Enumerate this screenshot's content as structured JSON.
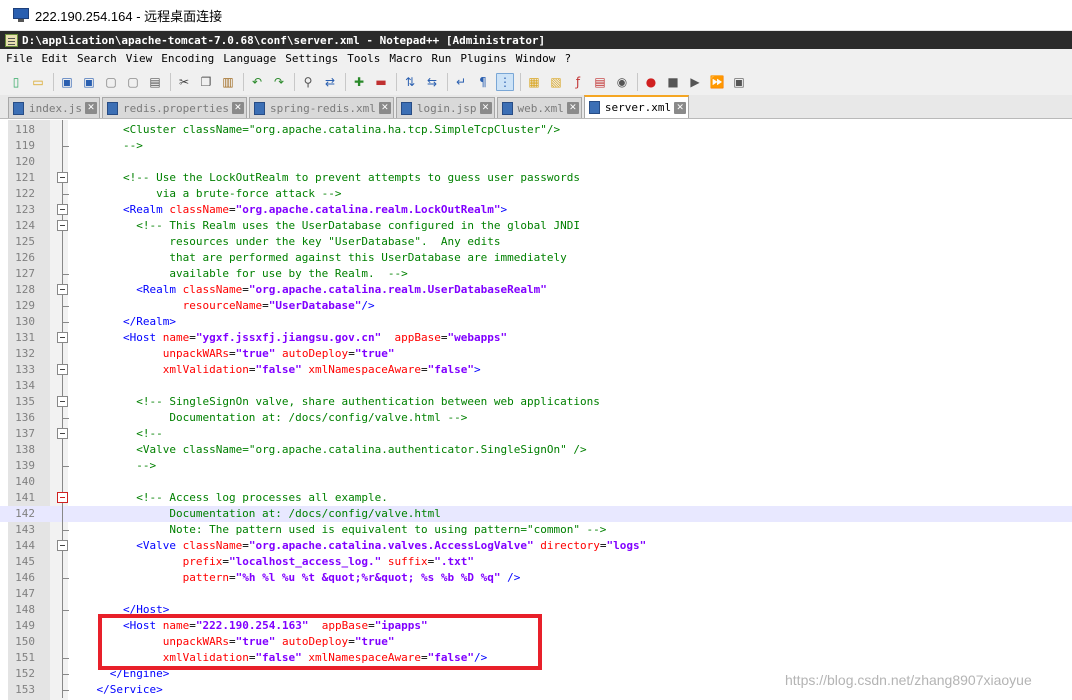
{
  "rdp": {
    "title": "222.190.254.164 - 远程桌面连接"
  },
  "window": {
    "title": "D:\\application\\apache-tomcat-7.0.68\\conf\\server.xml - Notepad++ [Administrator]"
  },
  "menu": [
    "File",
    "Edit",
    "Search",
    "View",
    "Encoding",
    "Language",
    "Settings",
    "Tools",
    "Macro",
    "Run",
    "Plugins",
    "Window",
    "?"
  ],
  "tabs": [
    {
      "label": "index.js",
      "active": false
    },
    {
      "label": "redis.properties",
      "active": false
    },
    {
      "label": "spring-redis.xml",
      "active": false
    },
    {
      "label": "login.jsp",
      "active": false
    },
    {
      "label": "web.xml",
      "active": false
    },
    {
      "label": "server.xml",
      "active": true
    }
  ],
  "toolbar": [
    "new-icon",
    "open-icon",
    "save-icon",
    "save-all-icon",
    "close-icon",
    "close-all-icon",
    "print-icon",
    "cut-icon",
    "copy-icon",
    "paste-icon",
    "undo-icon",
    "redo-icon",
    "find-icon",
    "replace-icon",
    "zoom-in-icon",
    "zoom-out-icon",
    "sync-v-icon",
    "sync-h-icon",
    "wrap-icon",
    "all-chars-icon",
    "indent-guide-icon",
    "udl-icon",
    "doc-map-icon",
    "function-list-icon",
    "folder-workspace-icon",
    "monitor-icon",
    "record-icon",
    "stop-icon",
    "play-icon",
    "run-multiple-icon",
    "save-macro-icon"
  ],
  "lines": [
    {
      "n": "118",
      "t": [
        [
          "        ",
          "txt"
        ],
        [
          "<Cluster className=\"org.apache.catalina.ha.tcp.SimpleTcpCluster\"/>",
          "com"
        ]
      ]
    },
    {
      "n": "119",
      "t": [
        [
          "        ",
          "txt"
        ],
        [
          "-->",
          "com"
        ]
      ]
    },
    {
      "n": "120",
      "t": []
    },
    {
      "n": "121",
      "t": [
        [
          "        ",
          "txt"
        ],
        [
          "<!-- Use the LockOutRealm to prevent attempts to guess user passwords",
          "com"
        ]
      ]
    },
    {
      "n": "122",
      "t": [
        [
          "             via a brute-force attack -->",
          "com"
        ]
      ]
    },
    {
      "n": "123",
      "t": [
        [
          "        ",
          "txt"
        ],
        [
          "<Realm ",
          "tag"
        ],
        [
          "className",
          "att"
        ],
        [
          "=",
          "txt"
        ],
        [
          "\"org.apache.catalina.realm.LockOutRealm\"",
          "val"
        ],
        [
          ">",
          "tag"
        ]
      ]
    },
    {
      "n": "124",
      "t": [
        [
          "          ",
          "txt"
        ],
        [
          "<!-- This Realm uses the UserDatabase configured in the global JNDI",
          "com"
        ]
      ]
    },
    {
      "n": "125",
      "t": [
        [
          "               resources under the key \"UserDatabase\".  Any edits",
          "com"
        ]
      ]
    },
    {
      "n": "126",
      "t": [
        [
          "               that are performed against this UserDatabase are immediately",
          "com"
        ]
      ]
    },
    {
      "n": "127",
      "t": [
        [
          "               available for use by the Realm.  -->",
          "com"
        ]
      ]
    },
    {
      "n": "128",
      "t": [
        [
          "          ",
          "txt"
        ],
        [
          "<Realm ",
          "tag"
        ],
        [
          "className",
          "att"
        ],
        [
          "=",
          "txt"
        ],
        [
          "\"org.apache.catalina.realm.UserDatabaseRealm\"",
          "val"
        ]
      ]
    },
    {
      "n": "129",
      "t": [
        [
          "                 ",
          "txt"
        ],
        [
          "resourceName",
          "att"
        ],
        [
          "=",
          "txt"
        ],
        [
          "\"UserDatabase\"",
          "val"
        ],
        [
          "/>",
          "tag"
        ]
      ]
    },
    {
      "n": "130",
      "t": [
        [
          "        ",
          "txt"
        ],
        [
          "</Realm>",
          "tag"
        ]
      ]
    },
    {
      "n": "131",
      "t": [
        [
          "        ",
          "txt"
        ],
        [
          "<Host ",
          "tag"
        ],
        [
          "name",
          "att"
        ],
        [
          "=",
          "txt"
        ],
        [
          "\"ygxf.jssxfj.jiangsu.gov.cn\"",
          "val"
        ],
        [
          "  ",
          "txt"
        ],
        [
          "appBase",
          "att"
        ],
        [
          "=",
          "txt"
        ],
        [
          "\"webapps\"",
          "val"
        ]
      ]
    },
    {
      "n": "132",
      "t": [
        [
          "              ",
          "txt"
        ],
        [
          "unpackWARs",
          "att"
        ],
        [
          "=",
          "txt"
        ],
        [
          "\"true\"",
          "val"
        ],
        [
          " ",
          "txt"
        ],
        [
          "autoDeploy",
          "att"
        ],
        [
          "=",
          "txt"
        ],
        [
          "\"true\"",
          "val"
        ]
      ]
    },
    {
      "n": "133",
      "t": [
        [
          "              ",
          "txt"
        ],
        [
          "xmlValidation",
          "att"
        ],
        [
          "=",
          "txt"
        ],
        [
          "\"false\"",
          "val"
        ],
        [
          " ",
          "txt"
        ],
        [
          "xmlNamespaceAware",
          "att"
        ],
        [
          "=",
          "txt"
        ],
        [
          "\"false\"",
          "val"
        ],
        [
          ">",
          "tag"
        ]
      ]
    },
    {
      "n": "134",
      "t": []
    },
    {
      "n": "135",
      "t": [
        [
          "          ",
          "txt"
        ],
        [
          "<!-- SingleSignOn valve, share authentication between web applications",
          "com"
        ]
      ]
    },
    {
      "n": "136",
      "t": [
        [
          "               Documentation at: /docs/config/valve.html -->",
          "com"
        ]
      ]
    },
    {
      "n": "137",
      "t": [
        [
          "          ",
          "txt"
        ],
        [
          "<!--",
          "com"
        ]
      ]
    },
    {
      "n": "138",
      "t": [
        [
          "          ",
          "txt"
        ],
        [
          "<Valve className=\"org.apache.catalina.authenticator.SingleSignOn\" />",
          "com"
        ]
      ]
    },
    {
      "n": "139",
      "t": [
        [
          "          ",
          "txt"
        ],
        [
          "-->",
          "com"
        ]
      ]
    },
    {
      "n": "140",
      "t": []
    },
    {
      "n": "141",
      "t": [
        [
          "          ",
          "txt"
        ],
        [
          "<!-- Access log processes all example.",
          "com"
        ]
      ]
    },
    {
      "n": "142",
      "t": [
        [
          "               Documentation at: /docs/config/valve.html",
          "com"
        ]
      ]
    },
    {
      "n": "143",
      "t": [
        [
          "               Note: The pattern used is equivalent to using pattern=\"common\" -->",
          "com"
        ]
      ]
    },
    {
      "n": "144",
      "t": [
        [
          "          ",
          "txt"
        ],
        [
          "<Valve ",
          "tag"
        ],
        [
          "className",
          "att"
        ],
        [
          "=",
          "txt"
        ],
        [
          "\"org.apache.catalina.valves.AccessLogValve\"",
          "val"
        ],
        [
          " ",
          "txt"
        ],
        [
          "directory",
          "att"
        ],
        [
          "=",
          "txt"
        ],
        [
          "\"logs\"",
          "val"
        ]
      ]
    },
    {
      "n": "145",
      "t": [
        [
          "                 ",
          "txt"
        ],
        [
          "prefix",
          "att"
        ],
        [
          "=",
          "txt"
        ],
        [
          "\"localhost_access_log.\"",
          "val"
        ],
        [
          " ",
          "txt"
        ],
        [
          "suffix",
          "att"
        ],
        [
          "=",
          "txt"
        ],
        [
          "\".txt\"",
          "val"
        ]
      ]
    },
    {
      "n": "146",
      "t": [
        [
          "                 ",
          "txt"
        ],
        [
          "pattern",
          "att"
        ],
        [
          "=",
          "txt"
        ],
        [
          "\"%h %l %u %t &quot;%r&quot; %s %b %D %q\"",
          "val"
        ],
        [
          " />",
          "tag"
        ]
      ]
    },
    {
      "n": "147",
      "t": []
    },
    {
      "n": "148",
      "t": [
        [
          "        ",
          "txt"
        ],
        [
          "</Host>",
          "tag"
        ]
      ]
    },
    {
      "n": "149",
      "t": [
        [
          "        ",
          "txt"
        ],
        [
          "<Host ",
          "tag"
        ],
        [
          "name",
          "att"
        ],
        [
          "=",
          "txt"
        ],
        [
          "\"222.190.254.163\"",
          "val"
        ],
        [
          "  ",
          "txt"
        ],
        [
          "appBase",
          "att"
        ],
        [
          "=",
          "txt"
        ],
        [
          "\"ipapps\"",
          "val"
        ]
      ]
    },
    {
      "n": "150",
      "t": [
        [
          "              ",
          "txt"
        ],
        [
          "unpackWARs",
          "att"
        ],
        [
          "=",
          "txt"
        ],
        [
          "\"true\"",
          "val"
        ],
        [
          " ",
          "txt"
        ],
        [
          "autoDeploy",
          "att"
        ],
        [
          "=",
          "txt"
        ],
        [
          "\"true\"",
          "val"
        ]
      ]
    },
    {
      "n": "151",
      "t": [
        [
          "              ",
          "txt"
        ],
        [
          "xmlValidation",
          "att"
        ],
        [
          "=",
          "txt"
        ],
        [
          "\"false\"",
          "val"
        ],
        [
          " ",
          "txt"
        ],
        [
          "xmlNamespaceAware",
          "att"
        ],
        [
          "=",
          "txt"
        ],
        [
          "\"false\"",
          "val"
        ],
        [
          "/>",
          "tag"
        ]
      ]
    },
    {
      "n": "152",
      "t": [
        [
          "      ",
          "txt"
        ],
        [
          "</Engine>",
          "tag"
        ]
      ]
    },
    {
      "n": "153",
      "t": [
        [
          "    ",
          "txt"
        ],
        [
          "</Service>",
          "tag"
        ]
      ]
    }
  ],
  "watermark": "https://blog.csdn.net/zhang8907xiaoyue"
}
